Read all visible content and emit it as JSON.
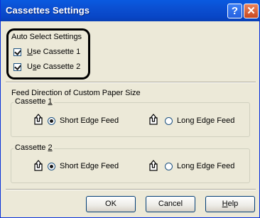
{
  "window": {
    "title": "Cassettes Settings",
    "help_glyph": "?",
    "close_glyph": "✕"
  },
  "auto_select": {
    "heading": "Auto Select Settings",
    "use_cassette_1": {
      "label_mnemonic": "U",
      "label_rest": "se Cassette 1",
      "checked": true
    },
    "use_cassette_2": {
      "label_pre": "U",
      "label_mnemonic": "s",
      "label_rest": "e Cassette 2",
      "checked": true
    }
  },
  "feed_direction": {
    "heading": "Feed Direction of Custom Paper Size",
    "groups": [
      {
        "legend_pre": "Cassette ",
        "legend_mnemonic": "1",
        "short_label": "Short Edge Feed",
        "long_label": "Long Edge Feed",
        "selected": "short"
      },
      {
        "legend_pre": "Cassette ",
        "legend_mnemonic": "2",
        "short_label": "Short Edge Feed",
        "long_label": "Long Edge Feed",
        "selected": "short"
      }
    ]
  },
  "buttons": {
    "ok": "OK",
    "cancel": "Cancel",
    "help_mnemonic": "H",
    "help_rest": "elp"
  },
  "icons": [
    "paper-feed-up-icon"
  ]
}
